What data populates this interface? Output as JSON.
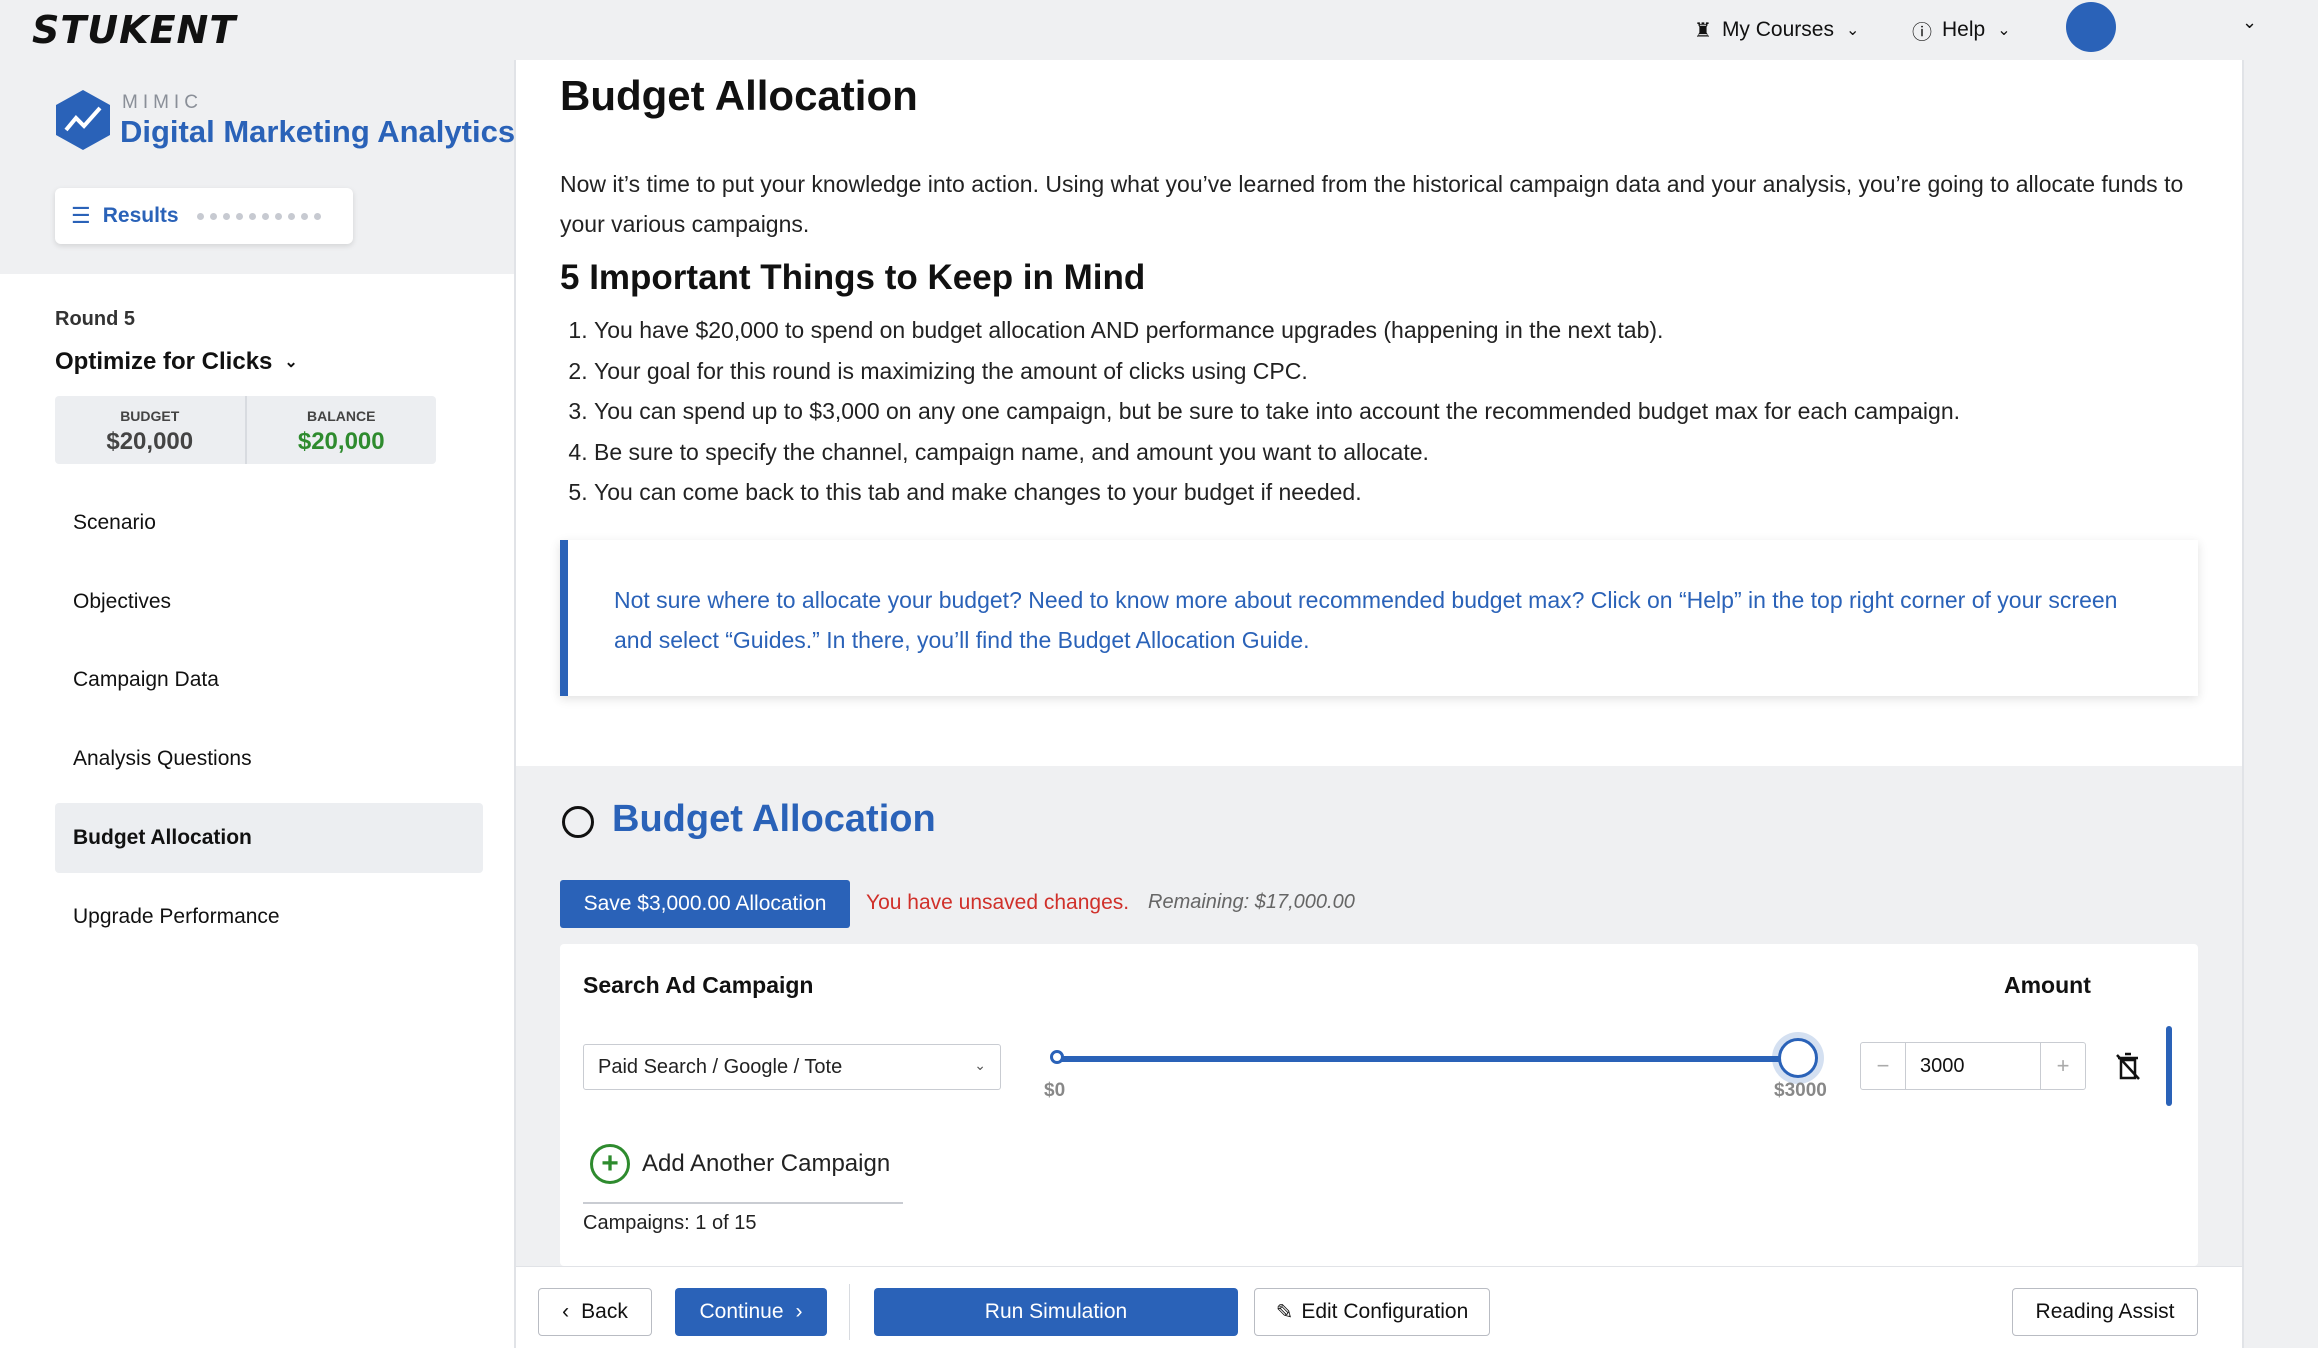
{
  "header": {
    "logo": "STUKENT",
    "my_courses": "My Courses",
    "help": "Help"
  },
  "sidebar": {
    "brand_small": "MIMIC",
    "brand_title": "Digital Marketing Analytics",
    "results_label": "Results",
    "round_label": "Round 5",
    "round_name": "Optimize for Clicks",
    "budget_label": "BUDGET",
    "budget_value": "$20,000",
    "balance_label": "BALANCE",
    "balance_value": "$20,000",
    "items": [
      {
        "label": "Scenario"
      },
      {
        "label": "Objectives"
      },
      {
        "label": "Campaign Data"
      },
      {
        "label": "Analysis Questions"
      },
      {
        "label": "Budget Allocation",
        "active": true
      },
      {
        "label": "Upgrade Performance"
      }
    ]
  },
  "main": {
    "title": "Budget Allocation",
    "intro": "Now it’s time to put your knowledge into action. Using what you’ve learned from the historical campaign data and your analysis, you’re going to allocate funds to your various campaigns.",
    "subtitle": "5 Important Things to Keep in Mind",
    "list": [
      "You have $20,000 to spend on budget allocation AND performance upgrades (happening in the next tab).",
      "Your goal for this round is maximizing the amount of clicks using CPC.",
      "You can spend up to $3,000 on any one campaign, but be sure to take into account the recommended budget max for each campaign.",
      "Be sure to specify the channel, campaign name, and amount you want to allocate.",
      "You can come back to this tab and make changes to your budget if needed."
    ],
    "callout": "Not sure where to allocate your budget? Need to know more about recommended budget max? Click on “Help” in the top right corner of your screen and select “Guides.” In there, you’ll find the Budget Allocation Guide."
  },
  "allocation": {
    "title": "Budget Allocation",
    "save_label": "Save $3,000.00 Allocation",
    "unsaved": "You have unsaved changes.",
    "remaining": "Remaining: $17,000.00",
    "card_title": "Search Ad Campaign",
    "amount_title": "Amount",
    "campaign_select": "Paid Search / Google / Tote",
    "slider_min": "$0",
    "slider_max": "$3000",
    "slider_value": 3000,
    "slider_max_value": 3000,
    "amount_value": "3000",
    "add_campaign": "Add Another Campaign",
    "campaign_count": "Campaigns: 1 of 15"
  },
  "footer": {
    "back": "Back",
    "continue": "Continue",
    "run": "Run Simulation",
    "edit": "Edit Configuration",
    "reading_assist": "Reading Assist"
  },
  "colors": {
    "accent": "#2a62b8",
    "success": "#2e8b2e",
    "warning": "#d0302a"
  }
}
